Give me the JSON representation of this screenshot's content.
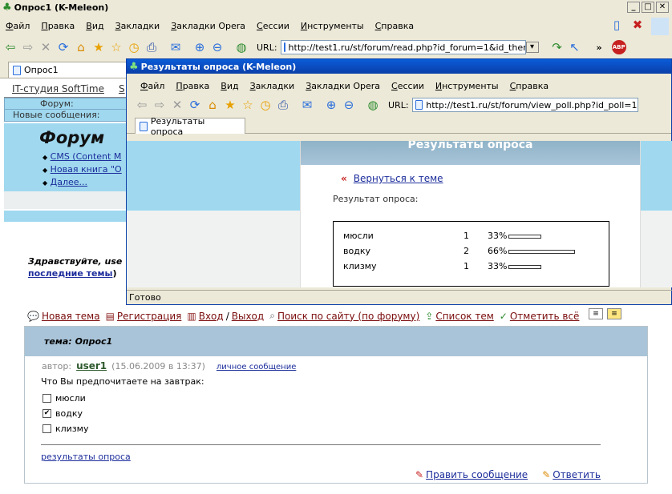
{
  "main_window": {
    "title": "Опрос1 (K-Meleon)",
    "menu": [
      "Файл",
      "Правка",
      "Вид",
      "Закладки",
      "Закладки Opera",
      "Сессии",
      "Инструменты",
      "Справка"
    ],
    "url_label": "URL:",
    "url": "http://test1.ru/st/forum/read.php?id_forum=1&id_them",
    "overflow": "»",
    "tab_label": "Опрос1"
  },
  "popup": {
    "title": "Результаты опроса (K-Meleon)",
    "menu": [
      "Файл",
      "Правка",
      "Вид",
      "Закладки",
      "Закладки Opera",
      "Сессии",
      "Инструменты",
      "Справка"
    ],
    "url_label": "URL:",
    "url": "http://test1.ru/st/forum/view_poll.php?id_poll=1",
    "tab_label": "Результаты опроса",
    "header": "Результаты опроса",
    "back_link": "Вернуться к теме",
    "result_label": "Результат опроса:",
    "results": [
      {
        "option": "мюсли",
        "votes": "1",
        "percent": "33%",
        "fraction": 0.33
      },
      {
        "option": "водку",
        "votes": "2",
        "percent": "66%",
        "fraction": 0.66
      },
      {
        "option": "клизму",
        "votes": "1",
        "percent": "33%",
        "fraction": 0.33
      }
    ],
    "status": "Готово"
  },
  "page": {
    "studio_link": "IT-студия SoftTime",
    "studio_link_cut": "S",
    "forum_label": "Форум:",
    "new_messages_label": "Новые сообщения:",
    "forum_heading": "Форум",
    "bullets": [
      "CMS (Content M",
      "Новая книга \"О",
      "Далее..."
    ],
    "greeting": "Здравствуйте, use",
    "last_topics": "последние темы",
    "last_topics_paren": ")",
    "nav": {
      "new_topic": "Новая тема",
      "register": "Регистрация",
      "login": "Вход",
      "slash": "/",
      "logout": "Выход",
      "search": "Поиск по сайту (по форуму)",
      "topic_list": "Список тем",
      "mark_all": "Отметить всё"
    },
    "topic_label": "тема:",
    "topic_name": "Опрос1",
    "author_label": "автор:",
    "author": "user1",
    "date": "(15.06.2009 в 13:37)",
    "private_message": "личное сообщение",
    "question": "Что Вы предпочитаете на завтрак:",
    "options": [
      {
        "label": "мюсли",
        "checked": false
      },
      {
        "label": "водку",
        "checked": true
      },
      {
        "label": "клизму",
        "checked": false
      }
    ],
    "results_link": "результаты опроса",
    "edit_message": "Править сообщение",
    "reply": "Ответить"
  }
}
